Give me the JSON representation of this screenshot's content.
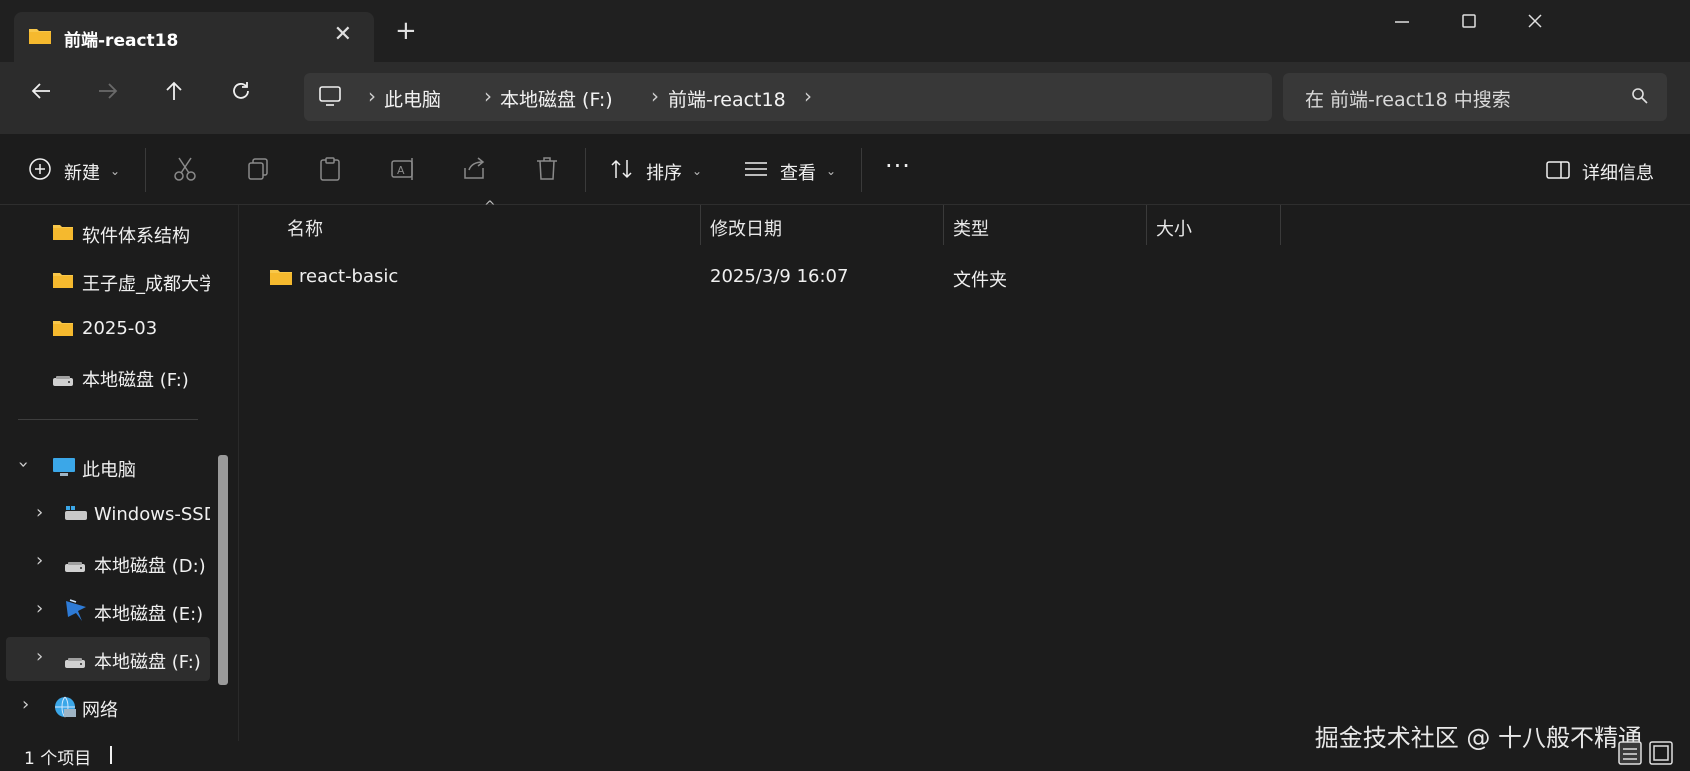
{
  "tab": {
    "title": "前端-react18",
    "close_icon": "close-icon"
  },
  "window": {
    "new_tab": "+",
    "minimize": "minimize-icon",
    "maximize": "maximize-icon",
    "close": "close-icon"
  },
  "breadcrumb": [
    "此电脑",
    "本地磁盘 (F:)",
    "前端-react18"
  ],
  "search": {
    "placeholder": "在 前端-react18 中搜索"
  },
  "toolbar": {
    "new_label": "新建",
    "sort_label": "排序",
    "view_label": "查看",
    "more_label": "···",
    "details_label": "详细信息"
  },
  "sidebar": {
    "quick": [
      {
        "label": "软件体系结构",
        "icon": "folder-icon"
      },
      {
        "label": "王子虚_成都大学",
        "icon": "folder-icon"
      },
      {
        "label": "2025-03",
        "icon": "folder-icon"
      },
      {
        "label": "本地磁盘 (F:)",
        "icon": "drive-icon"
      }
    ],
    "this_pc": {
      "label": "此电脑",
      "icon": "computer-icon"
    },
    "drives": [
      {
        "label": "Windows-SSD",
        "icon": "drive-windows-icon"
      },
      {
        "label": "本地磁盘 (D:)",
        "icon": "drive-icon"
      },
      {
        "label": "本地磁盘 (E:)",
        "icon": "drive-custom-icon"
      },
      {
        "label": "本地磁盘 (F:)",
        "icon": "drive-icon",
        "selected": true
      }
    ],
    "network": {
      "label": "网络",
      "icon": "network-icon"
    }
  },
  "columns": [
    "名称",
    "修改日期",
    "类型",
    "大小"
  ],
  "files": [
    {
      "name": "react-basic",
      "modified": "2025/3/9 16:07",
      "type": "文件夹",
      "size": ""
    }
  ],
  "status": {
    "count": "1 个项目"
  },
  "watermark": "掘金技术社区 @ 十八般不精通",
  "colors": {
    "accent": "#4cc2ff",
    "folder": "#f8c74a",
    "background": "#1c1c1c"
  }
}
